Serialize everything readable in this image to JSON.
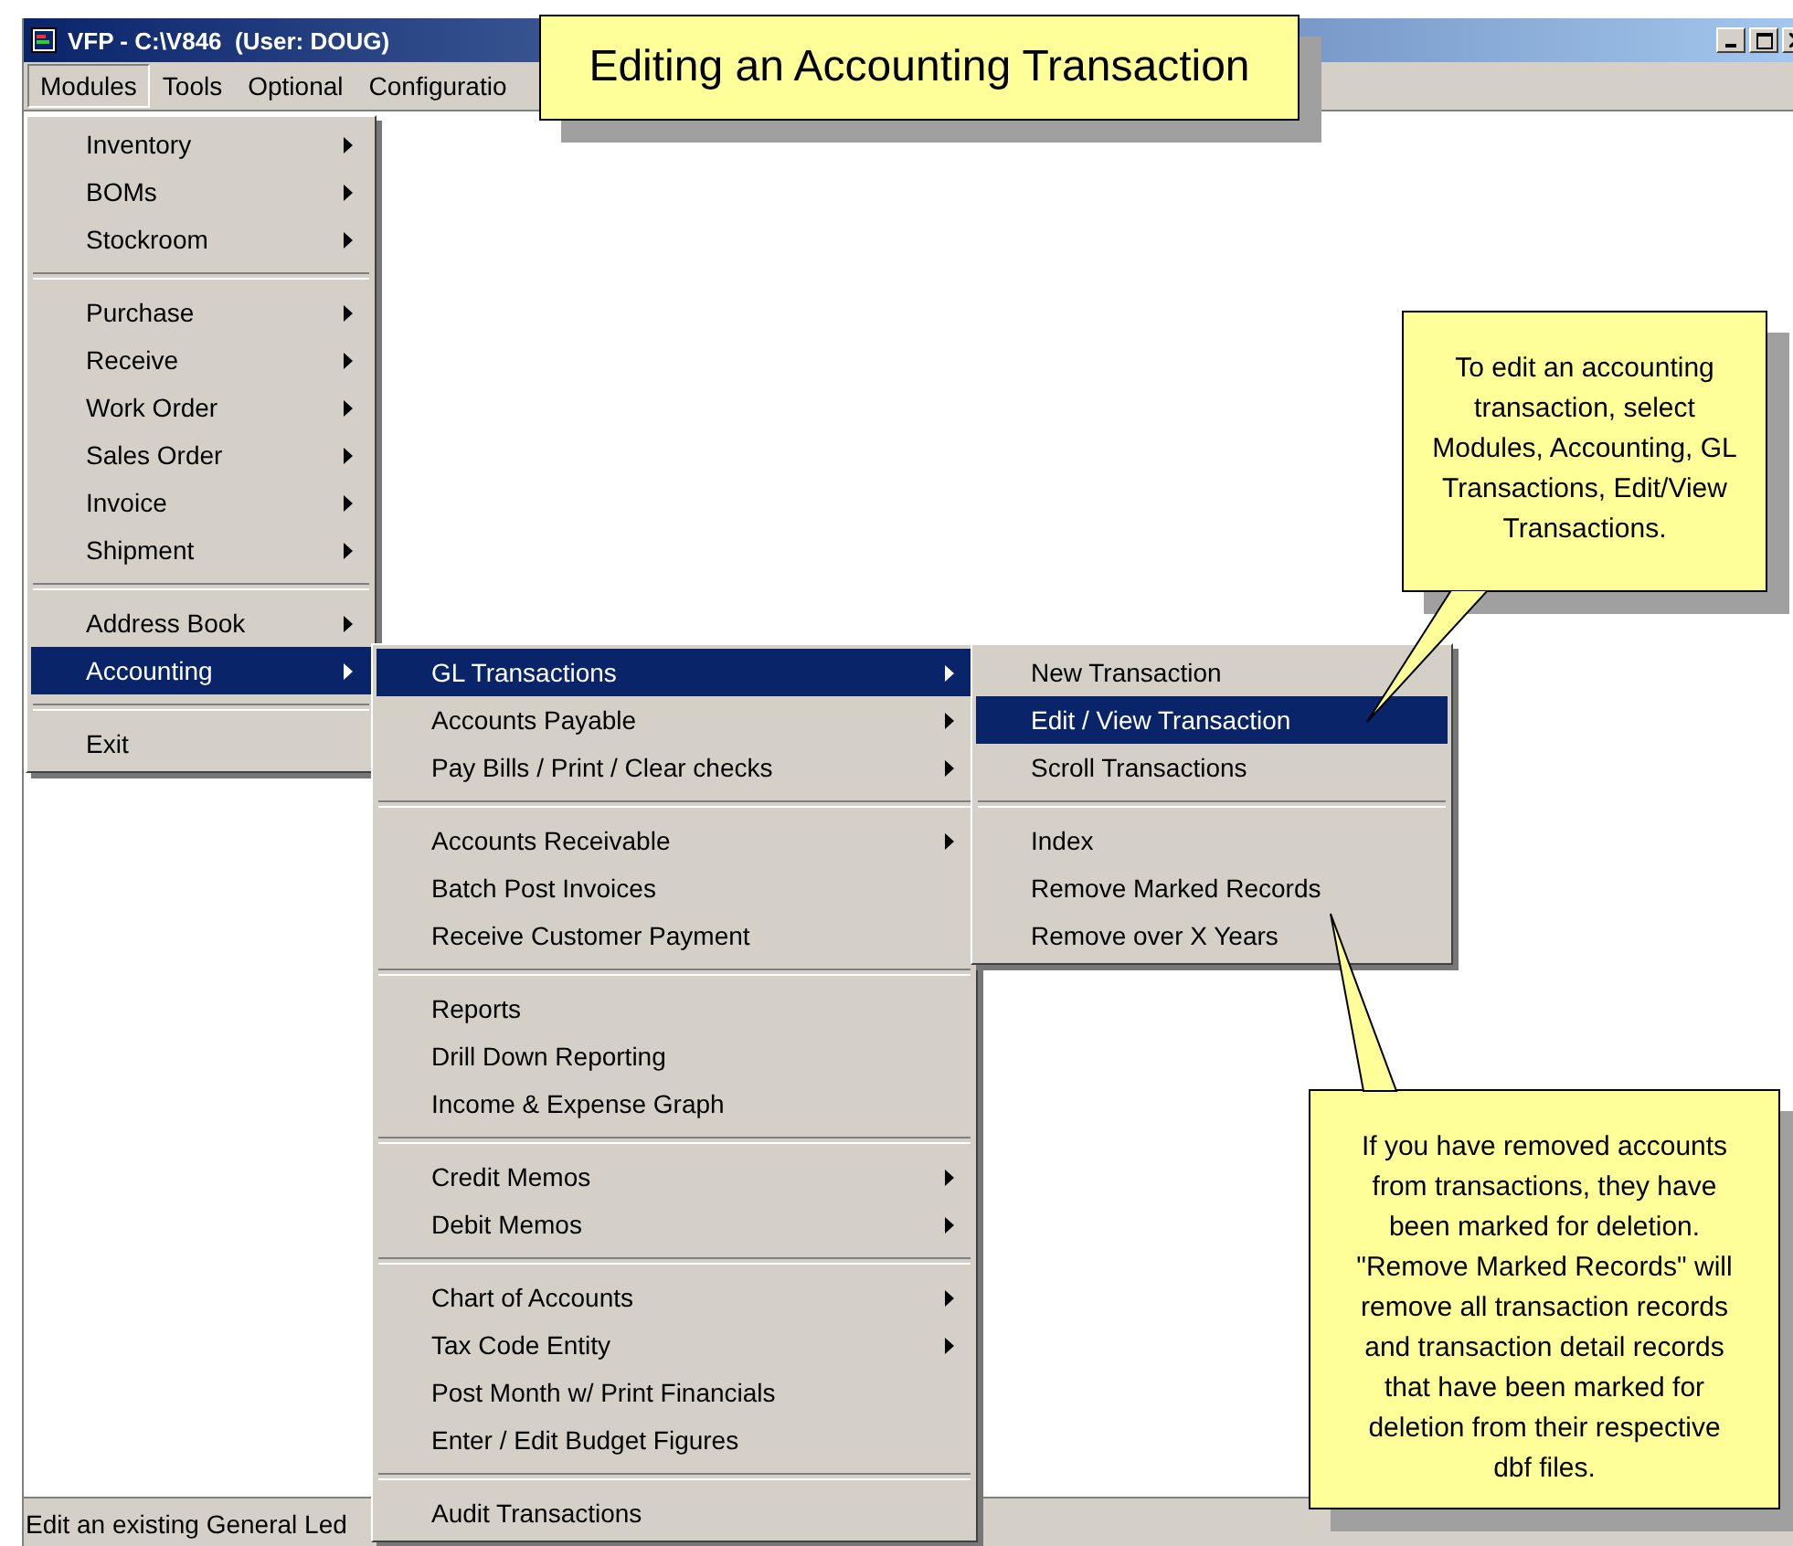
{
  "window": {
    "title": "VFP - C:\\V846  (User: DOUG)"
  },
  "menu_bar": [
    {
      "label": "Modules",
      "selected": true
    },
    {
      "label": "Tools",
      "selected": false
    },
    {
      "label": "Optional",
      "selected": false
    },
    {
      "label": "Configuratio",
      "selected": false
    }
  ],
  "modules_menu": {
    "groups": [
      [
        {
          "label": "Inventory",
          "submenu": true,
          "selected": false
        },
        {
          "label": "BOMs",
          "submenu": true,
          "selected": false
        },
        {
          "label": "Stockroom",
          "submenu": true,
          "selected": false
        }
      ],
      [
        {
          "label": "Purchase",
          "submenu": true,
          "selected": false
        },
        {
          "label": "Receive",
          "submenu": true,
          "selected": false
        },
        {
          "label": "Work Order",
          "submenu": true,
          "selected": false
        },
        {
          "label": "Sales Order",
          "submenu": true,
          "selected": false
        },
        {
          "label": "Invoice",
          "submenu": true,
          "selected": false
        },
        {
          "label": "Shipment",
          "submenu": true,
          "selected": false
        }
      ],
      [
        {
          "label": "Address Book",
          "submenu": true,
          "selected": false
        },
        {
          "label": "Accounting",
          "submenu": true,
          "selected": true
        }
      ],
      [
        {
          "label": "Exit",
          "submenu": false,
          "selected": false
        }
      ]
    ]
  },
  "accounting_menu": {
    "groups": [
      [
        {
          "label": "GL Transactions",
          "submenu": true,
          "selected": true
        },
        {
          "label": "Accounts Payable",
          "submenu": true,
          "selected": false
        },
        {
          "label": "Pay Bills / Print / Clear checks",
          "submenu": true,
          "selected": false
        }
      ],
      [
        {
          "label": "Accounts Receivable",
          "submenu": true,
          "selected": false
        },
        {
          "label": "Batch Post Invoices",
          "submenu": false,
          "selected": false
        },
        {
          "label": "Receive Customer Payment",
          "submenu": false,
          "selected": false
        }
      ],
      [
        {
          "label": "Reports",
          "submenu": false,
          "selected": false
        },
        {
          "label": "Drill Down Reporting",
          "submenu": false,
          "selected": false
        },
        {
          "label": "Income & Expense Graph",
          "submenu": false,
          "selected": false
        }
      ],
      [
        {
          "label": "Credit Memos",
          "submenu": true,
          "selected": false
        },
        {
          "label": "Debit Memos",
          "submenu": true,
          "selected": false
        }
      ],
      [
        {
          "label": "Chart of Accounts",
          "submenu": true,
          "selected": false
        },
        {
          "label": "Tax Code Entity",
          "submenu": true,
          "selected": false
        },
        {
          "label": "Post Month w/ Print Financials",
          "submenu": false,
          "selected": false
        },
        {
          "label": "Enter / Edit Budget Figures",
          "submenu": false,
          "selected": false
        }
      ],
      [
        {
          "label": "Audit Transactions",
          "submenu": false,
          "selected": false
        }
      ]
    ]
  },
  "gl_menu": {
    "groups": [
      [
        {
          "label": "New Transaction",
          "submenu": false,
          "selected": false
        },
        {
          "label": "Edit / View Transaction",
          "submenu": false,
          "selected": true
        },
        {
          "label": "Scroll Transactions",
          "submenu": false,
          "selected": false
        }
      ],
      [
        {
          "label": "Index",
          "submenu": false,
          "selected": false
        },
        {
          "label": "Remove Marked Records",
          "submenu": false,
          "selected": false
        },
        {
          "label": "Remove over X Years",
          "submenu": false,
          "selected": false
        }
      ]
    ]
  },
  "callouts": [
    {
      "kind": "banner",
      "text": "Editing an Accounting Transaction"
    },
    {
      "kind": "pointer-down",
      "text": "To edit an accounting transaction, select Modules, Accounting, GL Transactions, Edit/View Transactions."
    },
    {
      "kind": "pointer-up",
      "text": "If you have removed accounts from transactions, they have been marked for deletion. \"Remove Marked Records\" will remove all transaction records and transaction detail records that have been marked for deletion from their respective dbf files."
    }
  ],
  "status_bar": {
    "text": "Edit an existing General Led"
  }
}
